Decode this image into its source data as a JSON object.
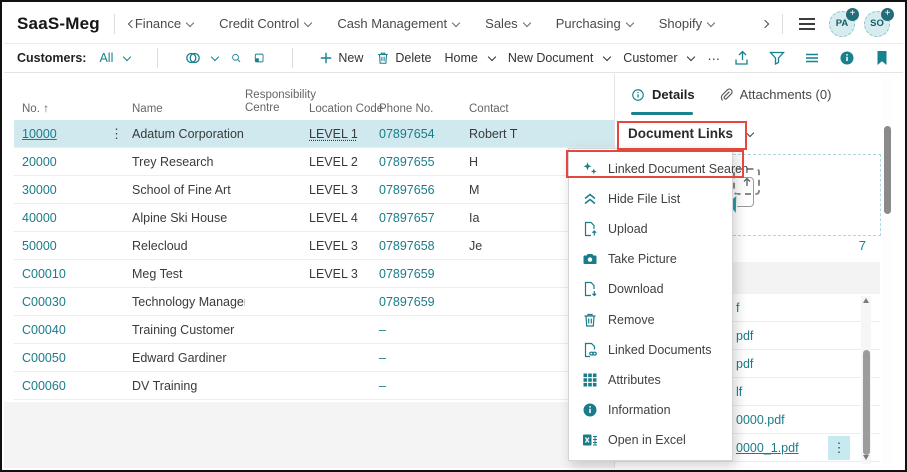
{
  "app": {
    "title": "SaaS-Meg"
  },
  "topnav": {
    "items": [
      {
        "label": "Finance"
      },
      {
        "label": "Credit Control"
      },
      {
        "label": "Cash Management"
      },
      {
        "label": "Sales"
      },
      {
        "label": "Purchasing"
      },
      {
        "label": "Shopify"
      }
    ],
    "avatars": [
      {
        "initials": "PA"
      },
      {
        "initials": "SO"
      }
    ]
  },
  "toolbar": {
    "context_label": "Customers:",
    "view_filter": "All",
    "new_label": "New",
    "delete_label": "Delete",
    "home_label": "Home",
    "new_document_label": "New Document",
    "customer_label": "Customer"
  },
  "icons": {
    "row_menu": "⋮",
    "toolbar_more": "⋯",
    "file_menu": "⋮",
    "plus_badge": "+"
  },
  "table": {
    "columns": [
      "No. ↑",
      "Name",
      "Responsibility Centre",
      "Location Code",
      "Phone No.",
      "Contact"
    ],
    "rows": [
      {
        "no": "10000",
        "name": "Adatum Corporation",
        "responsibility_centre": "",
        "location_code": "LEVEL 1",
        "phone": "07897654",
        "contact": "Robert T",
        "selected": true
      },
      {
        "no": "20000",
        "name": "Trey Research",
        "responsibility_centre": "",
        "location_code": "LEVEL 2",
        "phone": "07897655",
        "contact": "H"
      },
      {
        "no": "30000",
        "name": "School of Fine Art",
        "responsibility_centre": "",
        "location_code": "LEVEL 3",
        "phone": "07897656",
        "contact": "M"
      },
      {
        "no": "40000",
        "name": "Alpine Ski House",
        "responsibility_centre": "",
        "location_code": "LEVEL 4",
        "phone": "07897657",
        "contact": "Ia"
      },
      {
        "no": "50000",
        "name": "Relecloud",
        "responsibility_centre": "",
        "location_code": "LEVEL 3",
        "phone": "07897658",
        "contact": "Je"
      },
      {
        "no": "C00010",
        "name": "Meg Test",
        "responsibility_centre": "",
        "location_code": "LEVEL 3",
        "phone": "07897659",
        "contact": ""
      },
      {
        "no": "C00030",
        "name": "Technology Management",
        "responsibility_centre": "",
        "location_code": "",
        "phone": "07897659",
        "contact": ""
      },
      {
        "no": "C00040",
        "name": "Training Customer",
        "responsibility_centre": "",
        "location_code": "",
        "phone": "–",
        "contact": ""
      },
      {
        "no": "C00050",
        "name": "Edward Gardiner",
        "responsibility_centre": "",
        "location_code": "",
        "phone": "–",
        "contact": ""
      },
      {
        "no": "C00060",
        "name": "DV Training",
        "responsibility_centre": "",
        "location_code": "",
        "phone": "–",
        "contact": ""
      }
    ]
  },
  "details_panel": {
    "tabs": [
      {
        "label": "Details"
      },
      {
        "label": "Attachments (0)"
      }
    ],
    "document_links_label": "Document Links",
    "file_count": "7",
    "files": [
      {
        "label": "f"
      },
      {
        "label": "pdf"
      },
      {
        "label": "pdf"
      },
      {
        "label": "lf"
      },
      {
        "label": "0000.pdf"
      },
      {
        "label": "0000_1.pdf",
        "selected": true
      }
    ]
  },
  "context_menu": {
    "items": [
      {
        "label": "Linked Document Search",
        "icon": "sparkles-icon",
        "highlighted": true
      },
      {
        "label": "Hide File List",
        "icon": "double-chevron-up-icon"
      },
      {
        "label": "Upload",
        "icon": "upload-icon"
      },
      {
        "label": "Take Picture",
        "icon": "camera-icon"
      },
      {
        "label": "Download",
        "icon": "download-icon"
      },
      {
        "label": "Remove",
        "icon": "trash-icon"
      },
      {
        "label": "Linked Documents",
        "icon": "linked-document-icon"
      },
      {
        "label": "Attributes",
        "icon": "grid-icon"
      },
      {
        "label": "Information",
        "icon": "info-icon"
      },
      {
        "label": "Open in Excel",
        "icon": "excel-icon"
      }
    ]
  },
  "colors": {
    "accent_teal": "#17818e",
    "annotation_red": "#e2483d",
    "row_highlight": "#cfe9ef"
  }
}
